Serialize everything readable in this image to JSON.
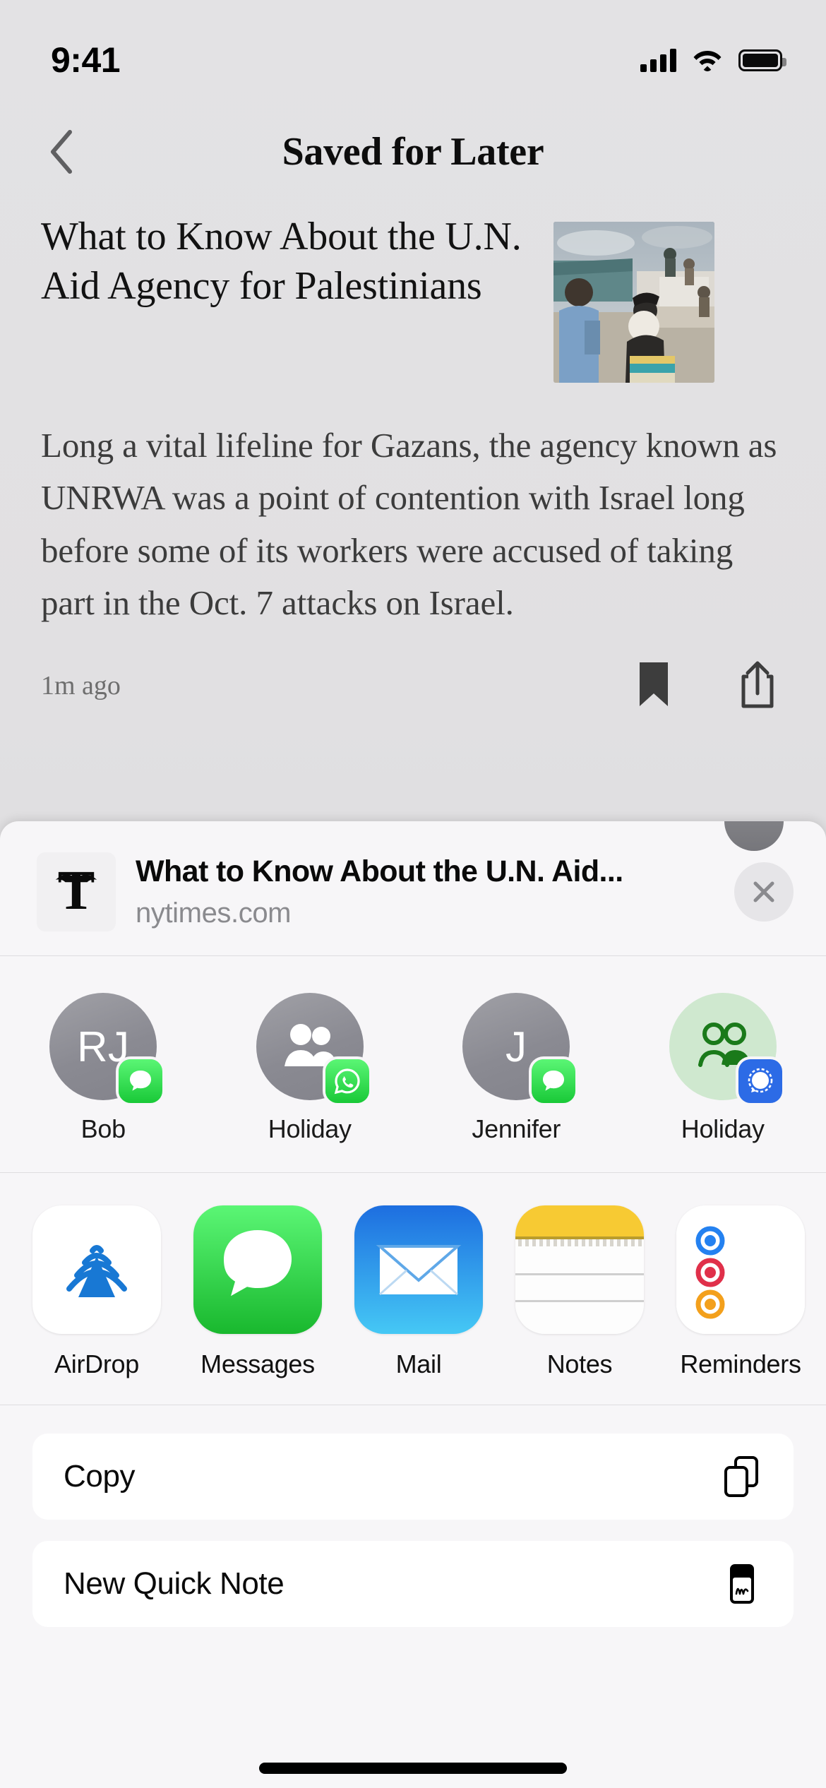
{
  "status_bar": {
    "time": "9:41",
    "cellular_icon": "cellular-signal-icon",
    "wifi_icon": "wifi-icon",
    "battery_icon": "battery-full-icon"
  },
  "nav": {
    "back_icon": "chevron-left-icon",
    "title": "Saved for Later"
  },
  "article": {
    "headline": "What to Know About the U.N. Aid Agency for Palestinians",
    "summary": "Long a vital lifeline for Gazans, the agency known as UNRWA was a point of contention with Israel long before some of its workers were accused of taking part in the Oct. 7 attacks on Israel.",
    "timestamp": "1m ago",
    "thumbnail_alt": "aid-distribution-photo",
    "bookmark_icon": "bookmark-filled-icon",
    "share_icon": "share-upload-icon"
  },
  "share_sheet": {
    "header": {
      "app_icon": "nytimes-logo-icon",
      "title": "What to Know About the U.N. Aid...",
      "domain": "nytimes.com",
      "close_icon": "close-x-icon",
      "avatar": "profile-avatar"
    },
    "contacts": [
      {
        "name": "Bob",
        "initials": "RJ",
        "avatar_type": "initials",
        "avatar_color": "#8a8a92",
        "badge": "imessage",
        "badge_label": "Messages"
      },
      {
        "name": "Holiday",
        "initials": "",
        "avatar_type": "group",
        "avatar_color": "#8a8a92",
        "badge": "whatsapp",
        "badge_label": "WhatsApp"
      },
      {
        "name": "Jennifer",
        "initials": "J",
        "avatar_type": "initials",
        "avatar_color": "#8a8a92",
        "badge": "imessage",
        "badge_label": "Messages"
      },
      {
        "name": "Holiday",
        "initials": "",
        "avatar_type": "group-green",
        "avatar_color": "#cfe8cf",
        "badge": "signal",
        "badge_label": "Signal"
      }
    ],
    "apps": [
      {
        "name": "AirDrop",
        "icon": "airdrop-icon"
      },
      {
        "name": "Messages",
        "icon": "messages-icon"
      },
      {
        "name": "Mail",
        "icon": "mail-icon"
      },
      {
        "name": "Notes",
        "icon": "notes-icon"
      },
      {
        "name": "Reminders",
        "icon": "reminders-icon"
      }
    ],
    "actions": [
      {
        "label": "Copy",
        "icon": "copy-doc-on-doc-icon"
      },
      {
        "label": "New Quick Note",
        "icon": "quick-note-icon"
      }
    ]
  },
  "colors": {
    "sheet_background": "#f7f6f8",
    "app_background": "#e2e1e3",
    "imessage_green": "#19c938",
    "signal_blue": "#2c6be6",
    "airdrop_blue": "#1878d4",
    "mail_blue": "#1d91f0",
    "notes_yellow": "#f7ca33"
  }
}
